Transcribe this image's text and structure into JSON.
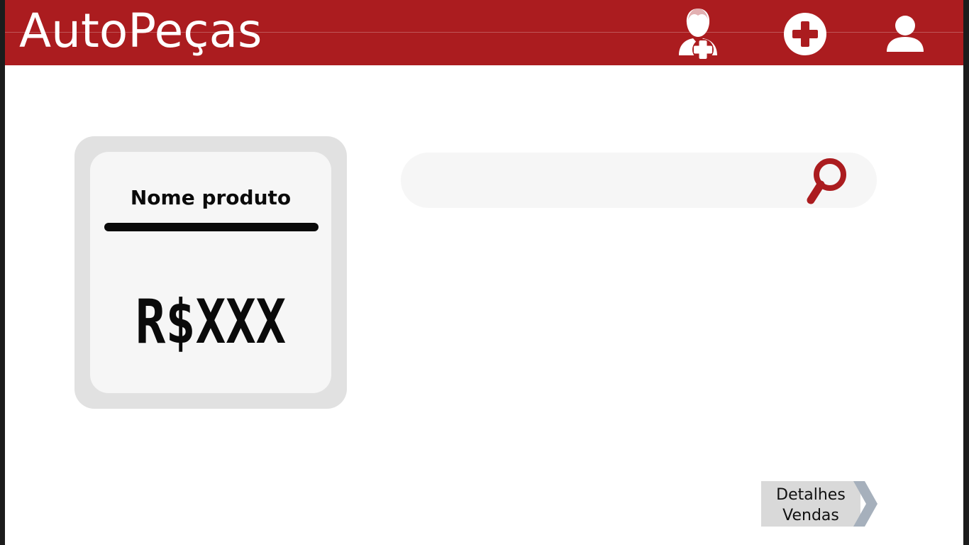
{
  "header": {
    "brand": "AutoPeças",
    "background_color": "#ab1c1f",
    "icons": [
      {
        "name": "add-user-icon"
      },
      {
        "name": "add-circle-icon"
      },
      {
        "name": "user-profile-icon"
      }
    ]
  },
  "product_card": {
    "name": "Nome produto",
    "price": "R$XXX"
  },
  "search": {
    "value": "",
    "icon": "search-icon",
    "accent_color": "#ab1c1f"
  },
  "details_button": {
    "line1": "Detalhes",
    "line2": "Vendas",
    "arrow_color": "#a6b0bc"
  }
}
